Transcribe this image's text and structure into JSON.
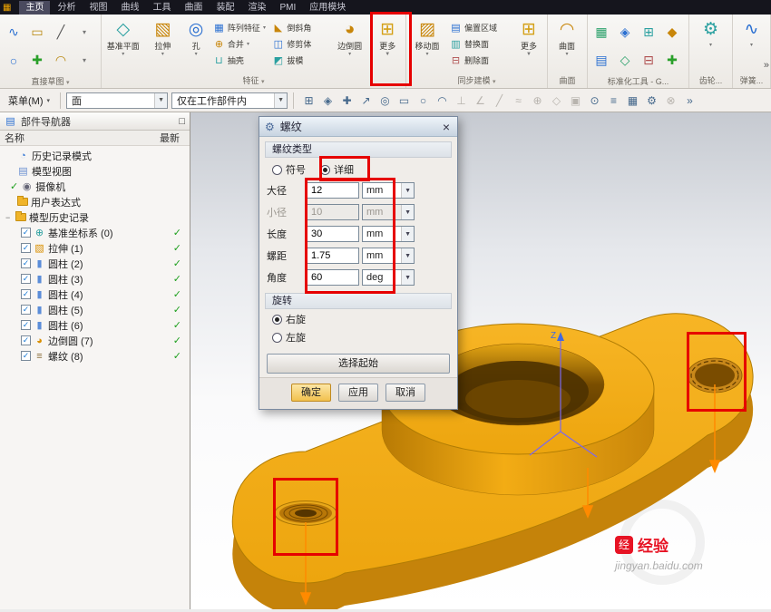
{
  "colors": {
    "annotation": "#e60000",
    "part_orange": "#f2a816",
    "ok_button": "#f2c14e"
  },
  "glyphs": {
    "window": "▦",
    "check": "✓",
    "close": "×",
    "gear": "⚙",
    "dropdown": "▼",
    "tiny_down": "▾",
    "detach": "□",
    "expander": "−",
    "scroll_more": "»",
    "spline": "∿",
    "rect": "▭",
    "line": "╱",
    "circle": "○",
    "plus": "✚",
    "arc": "◠",
    "datum_plane": "◇",
    "extrude": "▧",
    "hole": "◎",
    "pattern": "▦",
    "unite": "⊕",
    "shell": "⊔",
    "chamfer": "◣",
    "trim_body": "◫",
    "draft": "◩",
    "edge_blend": "◕",
    "more": "⊞",
    "move_face": "▨",
    "offset_region": "▤",
    "replace_face": "▥",
    "delete_face": "⊟",
    "surface": "◠",
    "std_icons": [
      "▦",
      "◈",
      "⊞",
      "◆",
      "▤",
      "◇",
      "⊟",
      "✚"
    ],
    "gear_tool": "⚙",
    "spring_tool": "∿",
    "clock": "◔",
    "views": "▤",
    "camera": "◉",
    "csys": "⊕",
    "cylinder": "▮",
    "thread": "≡"
  },
  "tabs": {
    "items": [
      "主页",
      "分析",
      "视图",
      "曲线",
      "工具",
      "曲面",
      "装配",
      "渲染",
      "PMI",
      "应用模块"
    ],
    "active_index": 0
  },
  "ribbon": {
    "sketch": {
      "label": "直接草图"
    },
    "feature": {
      "label": "特征",
      "datum_plane": "基准平面",
      "extrude": "拉伸",
      "hole": "孔",
      "pattern": "阵列特征",
      "unite": "合并",
      "shell": "抽壳",
      "chamfer": "倒斜角",
      "trim_body": "修剪体",
      "draft": "拔模",
      "edge_blend": "边倒圆",
      "more": "更多"
    },
    "sync": {
      "label": "同步建模",
      "move_face": "移动面",
      "offset_region": "偏置区域",
      "replace_face": "替换面",
      "delete_face": "删除面",
      "more": "更多"
    },
    "surface": {
      "label": "曲面",
      "surface_btn": "曲面"
    },
    "std": {
      "label": "标准化工具 - G..."
    },
    "gear": {
      "label": "齿轮..."
    },
    "spring": {
      "label": "弹簧..."
    }
  },
  "toolbar": {
    "menu": "菜单(M)",
    "type_filter": "面",
    "scope": "仅在工作部件内",
    "icons": [
      {
        "name": "grid-snap-icon",
        "glyph": "⊞"
      },
      {
        "name": "midpoint-snap-icon",
        "glyph": "◈"
      },
      {
        "name": "point-snap-icon",
        "glyph": "✚"
      },
      {
        "name": "vector-icon",
        "glyph": "↗"
      },
      {
        "name": "center-snap-icon",
        "glyph": "◎"
      },
      {
        "name": "rectangle-icon",
        "glyph": "▭"
      },
      {
        "name": "circle-icon",
        "glyph": "○"
      },
      {
        "name": "arc-icon",
        "glyph": "◠"
      },
      {
        "name": "perpendicular-icon",
        "glyph": "⊥"
      },
      {
        "name": "angle-icon",
        "glyph": "∠"
      },
      {
        "name": "line-icon",
        "glyph": "╱"
      },
      {
        "name": "curve-icon",
        "glyph": "≈"
      },
      {
        "name": "offset-icon",
        "glyph": "⊕"
      },
      {
        "name": "diamond-snap-icon",
        "glyph": "◇"
      },
      {
        "name": "panel-icon",
        "glyph": "▣"
      },
      {
        "name": "target-icon",
        "glyph": "⊙"
      },
      {
        "name": "list-icon",
        "glyph": "≡"
      },
      {
        "name": "mesh-icon",
        "glyph": "▦"
      },
      {
        "name": "settings-icon",
        "glyph": "⚙"
      },
      {
        "name": "no-snap-icon",
        "glyph": "⊗"
      },
      {
        "name": "more-icon",
        "glyph": "»"
      }
    ]
  },
  "navigator": {
    "title": "部件导航器",
    "col_name": "名称",
    "col_latest": "最新",
    "items": [
      {
        "label": "历史记录模式"
      },
      {
        "label": "模型视图"
      },
      {
        "label": "摄像机"
      },
      {
        "label": "用户表达式"
      },
      {
        "label": "模型历史记录"
      },
      {
        "label": "基准坐标系 (0)"
      },
      {
        "label": "拉伸 (1)"
      },
      {
        "label": "圆柱 (2)"
      },
      {
        "label": "圆柱 (3)"
      },
      {
        "label": "圆柱 (4)"
      },
      {
        "label": "圆柱 (5)"
      },
      {
        "label": "圆柱 (6)"
      },
      {
        "label": "边倒圆 (7)"
      },
      {
        "label": "螺纹 (8)"
      }
    ]
  },
  "dialog": {
    "title": "螺纹",
    "type_section": "螺纹类型",
    "radio_symbol": "符号",
    "radio_detailed": "详细",
    "fields": [
      {
        "label": "大径",
        "value": "12",
        "unit": "mm"
      },
      {
        "label": "小径",
        "value": "10",
        "unit": "mm"
      },
      {
        "label": "长度",
        "value": "30",
        "unit": "mm"
      },
      {
        "label": "螺距",
        "value": "1.75",
        "unit": "mm"
      },
      {
        "label": "角度",
        "value": "60",
        "unit": "deg"
      }
    ],
    "rotation_section": "旋转",
    "radio_right": "右旋",
    "radio_left": "左旋",
    "select_start": "选择起始",
    "ok": "确定",
    "apply": "应用",
    "cancel": "取消"
  },
  "viewport": {
    "z_label": "Z"
  },
  "watermark": {
    "logo_char": "经",
    "brand": "经验",
    "domain": "jingyan.baidu.com"
  }
}
